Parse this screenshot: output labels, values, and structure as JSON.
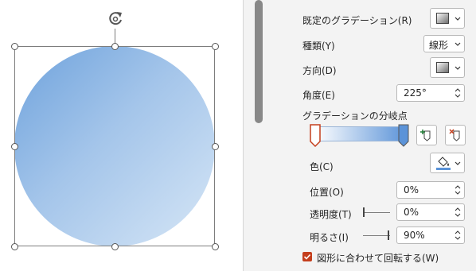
{
  "pane": {
    "preset_label": "既定のグラデーション(R)",
    "type_label": "種類(Y)",
    "type_value": "線形",
    "direction_label": "方向(D)",
    "angle_label": "角度(E)",
    "angle_value": "225°",
    "stops_heading": "グラデーションの分岐点",
    "color_label": "色(C)",
    "position_label": "位置(O)",
    "position_value": "0%",
    "transparency_label": "透明度(T)",
    "transparency_value": "0%",
    "brightness_label": "明るさ(I)",
    "brightness_value": "90%",
    "rotate_with_shape_label": "図形に合わせて回転する(W)",
    "rotate_with_shape_checked": true,
    "transparency_level": 0,
    "brightness_level": 0.9
  },
  "colors": {
    "accent": "#c43e1c",
    "gradient_start": "#6ea2dc",
    "gradient_end": "#d6e6f6"
  },
  "icons": [
    "rotate-icon",
    "gradient-preview-icon",
    "chevron-down-icon",
    "add-stop-icon",
    "remove-stop-icon",
    "paint-bucket-icon",
    "spin-arrows-icon",
    "checkmark-icon"
  ]
}
